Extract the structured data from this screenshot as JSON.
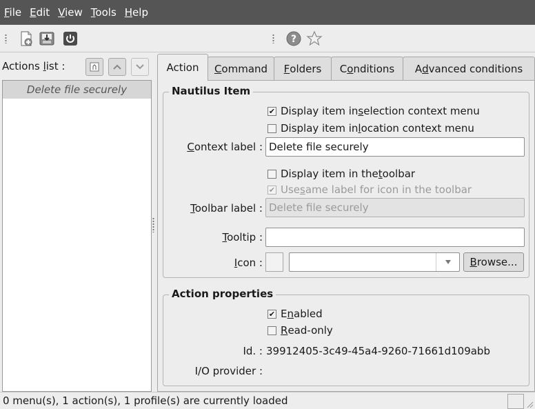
{
  "menubar": {
    "items": [
      {
        "pre": "",
        "key": "F",
        "post": "ile"
      },
      {
        "pre": "",
        "key": "E",
        "post": "dit"
      },
      {
        "pre": "",
        "key": "V",
        "post": "iew"
      },
      {
        "pre": "",
        "key": "T",
        "post": "ools"
      },
      {
        "pre": "",
        "key": "H",
        "post": "elp"
      }
    ]
  },
  "toolbar": {
    "icons": [
      "new-document-icon",
      "save-icon",
      "power-icon",
      "help-icon",
      "star-icon"
    ]
  },
  "actions_panel": {
    "header": {
      "pre": "Actions ",
      "key": "l",
      "post": "ist :"
    },
    "items": [
      "Delete file securely"
    ]
  },
  "tabs": [
    {
      "pre": "Action",
      "key": "",
      "post": ""
    },
    {
      "pre": "",
      "key": "C",
      "post": "ommand"
    },
    {
      "pre": "",
      "key": "F",
      "post": "olders"
    },
    {
      "pre": "C",
      "key": "o",
      "post": "nditions"
    },
    {
      "pre": "A",
      "key": "d",
      "post": "vanced conditions"
    }
  ],
  "nautilus": {
    "title": "Nautilus Item",
    "selection_menu": {
      "pre": "Display item in ",
      "key": "s",
      "post": "election context menu",
      "checked": true
    },
    "location_menu": {
      "pre": "Display item in ",
      "key": "l",
      "post": "ocation context menu",
      "checked": false
    },
    "context_label": {
      "pre": "",
      "key": "C",
      "post": "ontext label :",
      "value": "Delete file securely"
    },
    "toolbar_check": {
      "pre": "Display item in the ",
      "key": "t",
      "post": "oolbar",
      "checked": false
    },
    "same_label": {
      "pre": "Use ",
      "key": "s",
      "post": "ame label for icon in the toolbar",
      "checked": true
    },
    "toolbar_label": {
      "pre": "",
      "key": "T",
      "post": "oolbar label :",
      "value": "Delete file securely"
    },
    "tooltip": {
      "pre": "",
      "key": "T",
      "post": "ooltip :",
      "value": ""
    },
    "icon": {
      "pre": "",
      "key": "I",
      "post": "con :",
      "value": "",
      "browse_pre": "",
      "browse_key": "B",
      "browse_post": "rowse..."
    }
  },
  "properties": {
    "title": "Action properties",
    "enabled": {
      "pre": "E",
      "key": "n",
      "post": "abled",
      "checked": true
    },
    "readonly": {
      "pre": "",
      "key": "R",
      "post": "ead-only",
      "checked": false
    },
    "id_label": "Id. :",
    "id_value": "39912405-3c49-45a4-9260-71661d109abb",
    "io_label": "I/O provider :",
    "io_value": ""
  },
  "status": {
    "text": "0 menu(s), 1 action(s), 1 profile(s) are currently loaded"
  }
}
